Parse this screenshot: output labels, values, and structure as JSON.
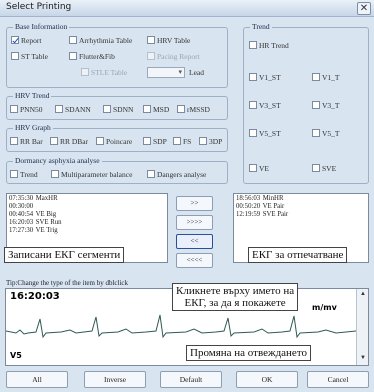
{
  "window": {
    "title": "Select Printing",
    "close_glyph": "✕"
  },
  "base_info": {
    "title": "Base Information",
    "items": [
      {
        "label": "Report",
        "checked": true,
        "enabled": true
      },
      {
        "label": "Arrhythmia Table",
        "checked": false,
        "enabled": true
      },
      {
        "label": "HRV Table",
        "checked": false,
        "enabled": true
      },
      {
        "label": "ST Table",
        "checked": false,
        "enabled": true
      },
      {
        "label": "Flutter&Fib",
        "checked": false,
        "enabled": true
      },
      {
        "label": "Pacing Report",
        "checked": false,
        "enabled": false
      },
      {
        "label": "STLE Table",
        "checked": false,
        "enabled": false
      }
    ],
    "lead_label": "Lead"
  },
  "hrv_trend": {
    "title": "HRV Trend",
    "items": [
      "PNN50",
      "SDANN",
      "SDNN",
      "MSD",
      "rMSSD"
    ]
  },
  "hrv_graph": {
    "title": "HRV Graph",
    "items": [
      "RR Bar",
      "RR DBar",
      "Poincare",
      "SDP",
      "FS",
      "3DP"
    ]
  },
  "dormancy": {
    "title": "Dormancy asphyxia analyse",
    "items": [
      "Trend",
      "Multiparameter balance",
      "Dangers analyse"
    ]
  },
  "trend": {
    "title": "Trend",
    "items": [
      "HR Trend",
      "V1_ST",
      "V1_T",
      "V3_ST",
      "V3_T",
      "V5_ST",
      "V5_T",
      "VE",
      "SVE"
    ]
  },
  "left_list": {
    "rows": [
      {
        "time": "07:35:30",
        "text": "MaxHR"
      },
      {
        "time": "00:30:00",
        "text": ""
      },
      {
        "time": "00:40:54",
        "text": "VE Big"
      },
      {
        "time": "16:20:03",
        "text": "SVE Run"
      },
      {
        "time": "17:27:30",
        "text": "VE Trig"
      }
    ]
  },
  "right_list": {
    "rows": [
      {
        "time": "18:56:03",
        "text": "MinHR"
      },
      {
        "time": "00:50:20",
        "text": "VE Pair"
      },
      {
        "time": "12:19:59",
        "text": "SVE Pair"
      }
    ]
  },
  "move_buttons": [
    ">>",
    ">>>>",
    "<<",
    "<<<<"
  ],
  "tip": "Tip:Change the type of the item by dblclick",
  "ecg": {
    "time": "16:20:03",
    "units": "m/mv",
    "lead": "V5"
  },
  "annotations": {
    "recorded": "Записани ЕКГ сегменти",
    "print": "ЕКГ за отпечатване",
    "click": "Кликнете върху името на\nЕКГ, за да я покажете",
    "lead_change": "Промяна на отвеждането"
  },
  "bottom_buttons": [
    "All",
    "Inverse",
    "Default",
    "OK",
    "Cancel"
  ],
  "colors": {
    "background": "#d8e4f0",
    "ecg_trace": "#2e5a55",
    "check": "#1f4db0"
  }
}
